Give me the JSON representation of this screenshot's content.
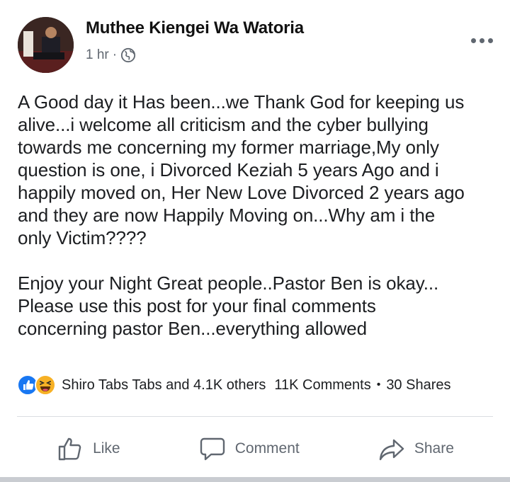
{
  "post": {
    "author": "Muthee Kiengei Wa Watoria",
    "time": "1 hr",
    "separator": "·",
    "text": "A Good day it Has been...we Thank God for keeping us\nalive...i welcome all criticism and the cyber bullying\ntowards me concerning my former marriage,My only\nquestion is one, i Divorced Keziah 5 years Ago and i\nhappily moved on, Her New Love Divorced 2 years ago\nand they are now Happily Moving on...Why am i the\nonly Victim????\n\nEnjoy your Night Great people..Pastor Ben is okay...\nPlease use this post for your final comments\nconcerning pastor Ben...everything allowed"
  },
  "reactions": {
    "icons": [
      "like-reaction-icon",
      "haha-reaction-icon"
    ],
    "names": "Shiro Tabs Tabs and 4.1K others",
    "comments": "11K Comments",
    "separator": "•",
    "shares": "30 Shares"
  },
  "actions": {
    "like": "Like",
    "comment": "Comment",
    "share": "Share"
  },
  "colors": {
    "like_blue": "#1877f2",
    "haha_yellow": "#f7b125",
    "secondary_text": "#606770"
  }
}
